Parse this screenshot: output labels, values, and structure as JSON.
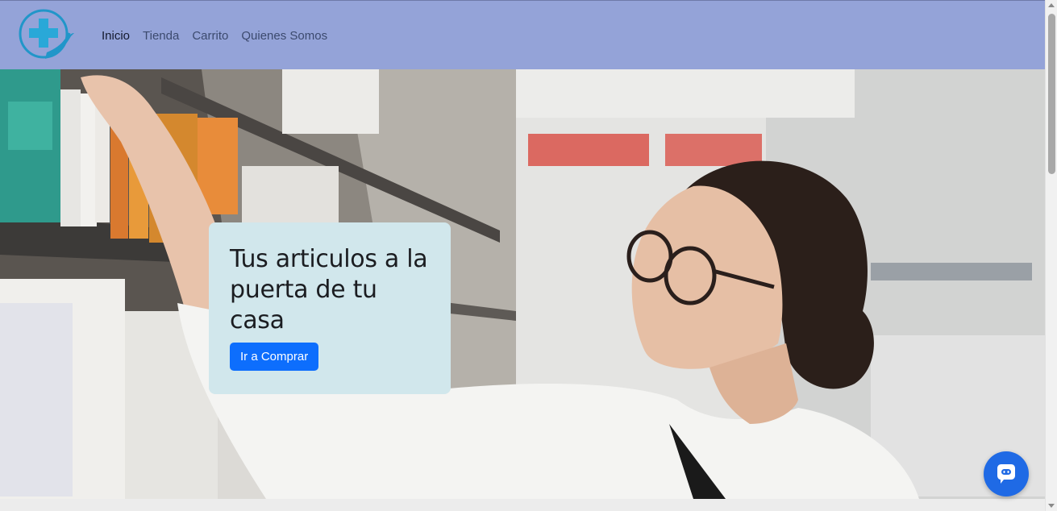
{
  "nav": {
    "logo_icon": "pharmacy-cross-hand-icon",
    "links": [
      {
        "label": "Inicio",
        "active": true
      },
      {
        "label": "Tienda",
        "active": false
      },
      {
        "label": "Carrito",
        "active": false
      },
      {
        "label": "Quienes Somos",
        "active": false
      }
    ]
  },
  "hero": {
    "title": "Tus articulos a la puerta de tu casa",
    "button_label": "Ir a Comprar",
    "image_icon": "pharmacist-photo"
  },
  "chat": {
    "icon": "chat-bot-icon"
  },
  "colors": {
    "navbar_bg": "#94a3d8",
    "card_bg": "#d1e7ec",
    "primary": "#0d6efd",
    "chat_bg": "#1f6ae5"
  }
}
